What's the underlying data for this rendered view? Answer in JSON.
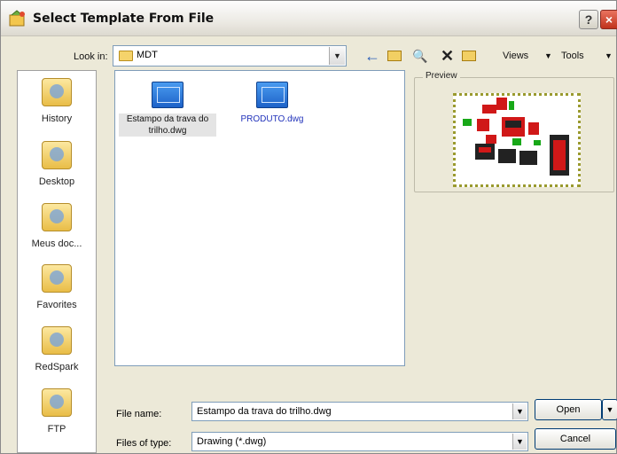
{
  "window": {
    "title": "Select Template From File",
    "help_glyph": "?",
    "close_glyph": "×"
  },
  "toolbar": {
    "look_in_label": "Look in:",
    "look_in_value": "MDT",
    "back_glyph": "←",
    "search_glyph": "🔍",
    "delete_glyph": "✕",
    "views_label": "Views",
    "tools_label": "Tools",
    "dropdown_glyph": "▼"
  },
  "places": [
    {
      "label": "History",
      "icon": "history-icon"
    },
    {
      "label": "Desktop",
      "icon": "desktop-icon"
    },
    {
      "label": "Meus doc...",
      "icon": "my-documents-icon"
    },
    {
      "label": "Favorites",
      "icon": "favorites-icon"
    },
    {
      "label": "RedSpark",
      "icon": "redspark-icon"
    },
    {
      "label": "FTP",
      "icon": "ftp-icon"
    }
  ],
  "files": [
    {
      "name": "Estampo da trava do trilho.dwg",
      "selected": true
    },
    {
      "name": "PRODUTO.dwg",
      "selected": false
    }
  ],
  "preview": {
    "label": "Preview"
  },
  "form": {
    "file_name_label": "File name:",
    "file_name_value": "Estampo da trava do trilho.dwg",
    "files_of_type_label": "Files of type:",
    "files_of_type_value": "Drawing (*.dwg)"
  },
  "buttons": {
    "open": "Open",
    "cancel": "Cancel"
  },
  "colors": {
    "dialog_bg": "#ece9d8",
    "selection_text": "#2233bb",
    "preview_red": "#d01818",
    "preview_green": "#18a818"
  }
}
